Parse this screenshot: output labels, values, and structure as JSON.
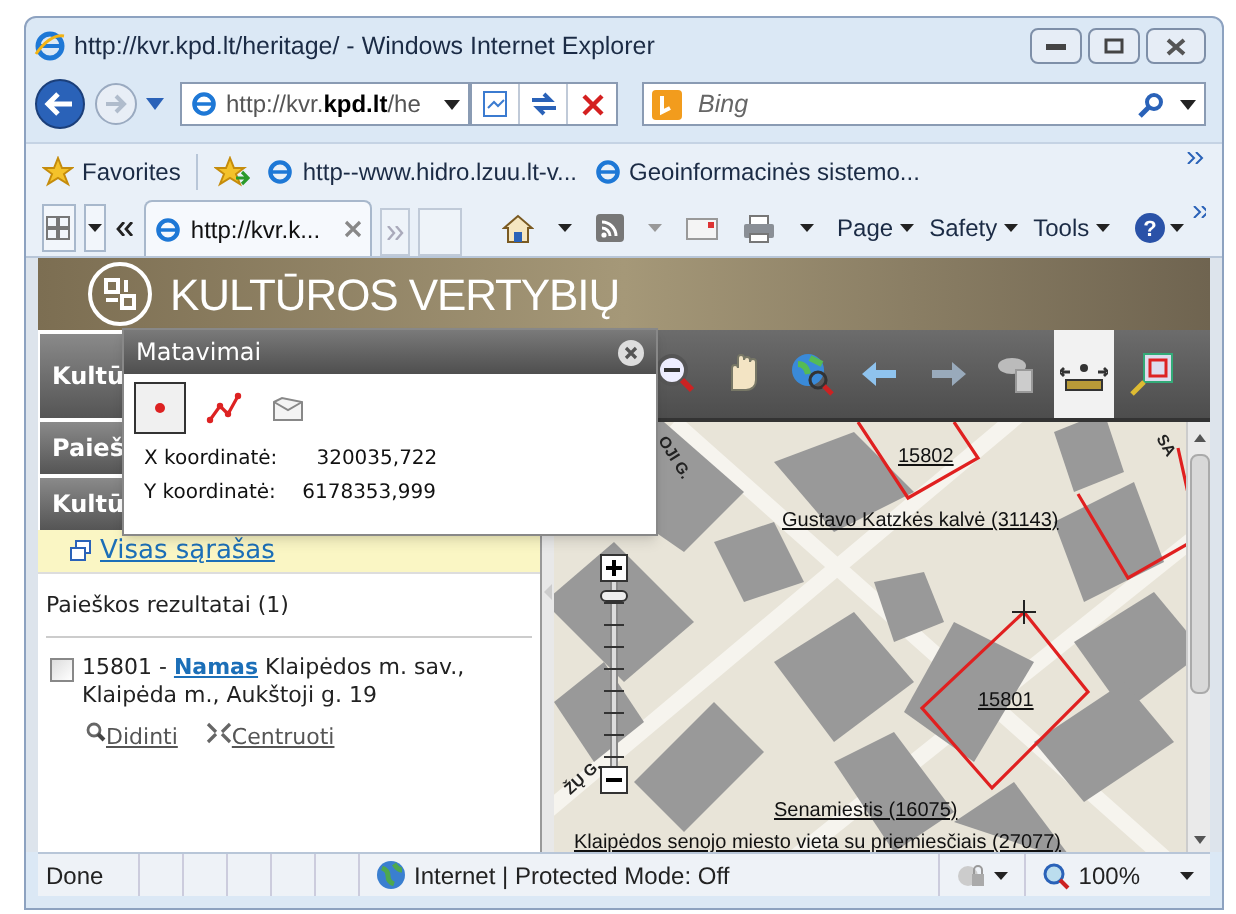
{
  "window": {
    "title": "http://kvr.kpd.lt/heritage/ - Windows Internet Explorer"
  },
  "address_bar": {
    "value": "http://kvr.**kpd.lt**/he"
  },
  "search": {
    "placeholder": "Bing"
  },
  "favorites": {
    "label": "Favorites",
    "links": [
      "http--www.hidro.lzuu.lt-v...",
      "Geoinformacinės sistemo..."
    ]
  },
  "tabs": [
    {
      "label": "http://kvr.k...",
      "selected": true
    }
  ],
  "command_bar": [
    "Page",
    "Safety",
    "Tools"
  ],
  "page": {
    "banner": "KULTŪROS VERTYBIŲ",
    "sidebar_sections": [
      "Kultū",
      "Paieš",
      "Kultū"
    ],
    "list_link": "Visas sąrašas",
    "results_heading": "Paieškos rezultatai (1)",
    "results": [
      {
        "checked": false,
        "prefix": "15801 - ",
        "link": "Namas",
        "suffix": " Klaipėdos m. sav., Klaipėda m., Aukštoji g. 19",
        "actions": [
          "Didinti",
          "Centruoti"
        ]
      }
    ]
  },
  "popup": {
    "title": "Matavimai",
    "tools": [
      {
        "kind": "point",
        "selected": true
      },
      {
        "kind": "line",
        "selected": false
      },
      {
        "kind": "area",
        "selected": false
      }
    ],
    "readings": [
      {
        "label": "X koordinatė:",
        "value": "320035,722"
      },
      {
        "label": "Y koordinatė:",
        "value": "6178353,999"
      }
    ]
  },
  "help_button": {
    "glyph": "?"
  },
  "map": {
    "tools": [
      {
        "kind": "zoom-out",
        "selected": false
      },
      {
        "kind": "pan",
        "selected": false
      },
      {
        "kind": "identify",
        "selected": false
      },
      {
        "kind": "back",
        "selected": false
      },
      {
        "kind": "forward",
        "selected": false
      },
      {
        "kind": "layers",
        "selected": false
      },
      {
        "kind": "measure",
        "selected": true
      },
      {
        "kind": "extent",
        "selected": false
      }
    ],
    "labels": [
      {
        "kind": "street",
        "text": "OJI G."
      },
      {
        "kind": "street",
        "text": "SA"
      },
      {
        "kind": "street",
        "text": "ŽŲ G."
      },
      {
        "kind": "object",
        "text": "15802"
      },
      {
        "kind": "object",
        "text": "Gustavo Katzkės kalvė (31143)"
      },
      {
        "kind": "object",
        "text": "15801"
      },
      {
        "kind": "object",
        "text": "Senamiestis (16075)"
      },
      {
        "kind": "object",
        "text": "Klaipėdos senojo miesto vieta su priemiesčiais (27077)"
      }
    ],
    "zoom": {
      "level": 0.95
    }
  },
  "status_bar": {
    "text": "Done",
    "zone": "Internet | Protected Mode: Off",
    "zoom": "100%"
  }
}
